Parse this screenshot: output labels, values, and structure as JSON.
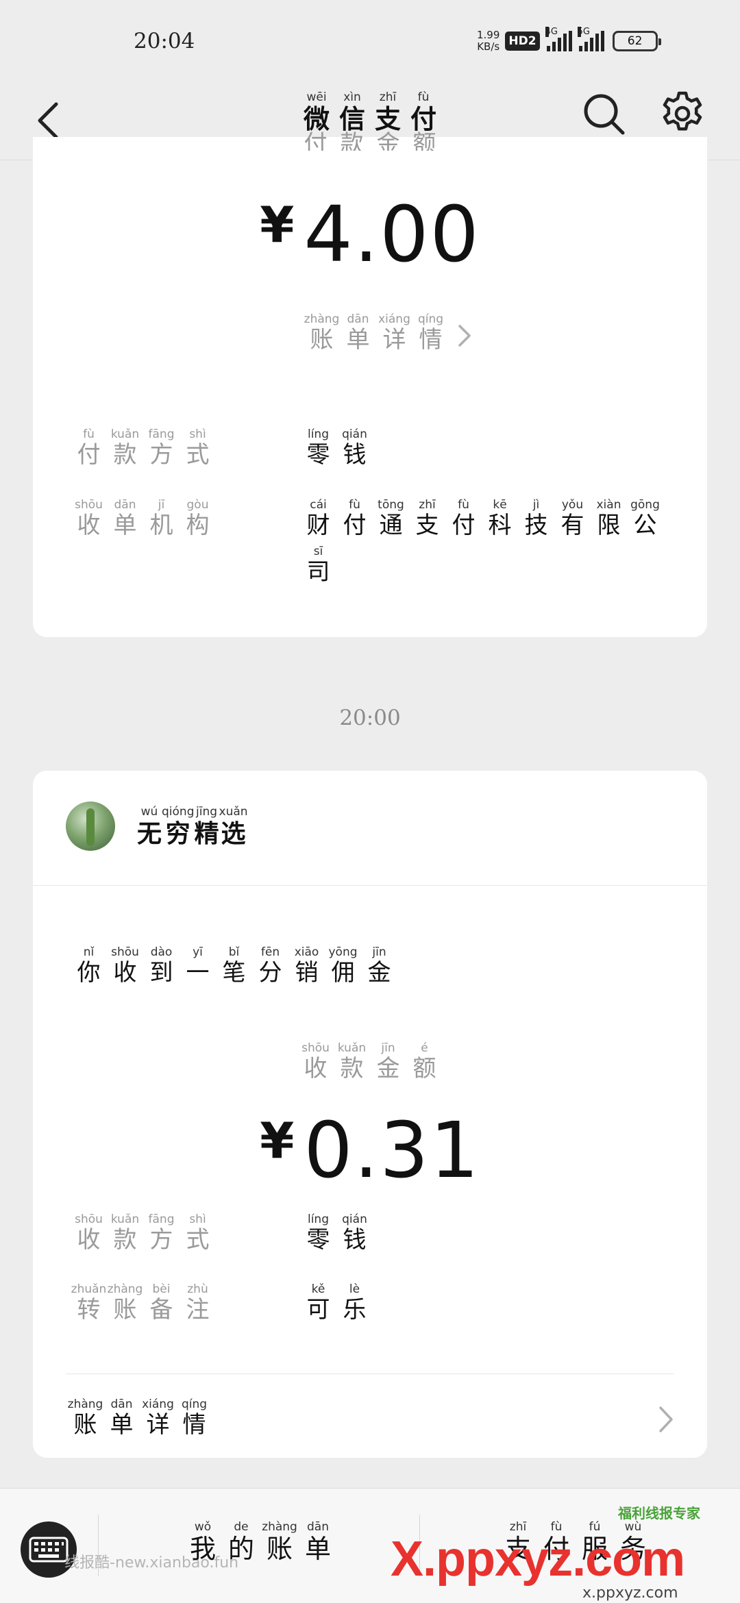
{
  "status_bar": {
    "time": "20:04",
    "net_speed_value": "1.99",
    "net_speed_unit": "KB/s",
    "hd_badge": "HD2",
    "sig1_label": "4G",
    "sig2_label": "5G",
    "battery": "62"
  },
  "nav": {
    "title": [
      {
        "py": "wēi",
        "hz": "微"
      },
      {
        "py": "xìn",
        "hz": "信"
      },
      {
        "py": "zhī",
        "hz": "支"
      },
      {
        "py": "fù",
        "hz": "付"
      }
    ],
    "back_icon": "chevron-left-icon",
    "search_icon": "search-icon",
    "settings_icon": "gear-icon"
  },
  "card1": {
    "partial_label": [
      {
        "py": "",
        "hz": "付"
      },
      {
        "py": "",
        "hz": "款"
      },
      {
        "py": "",
        "hz": "金"
      },
      {
        "py": "",
        "hz": "额"
      }
    ],
    "currency": "¥",
    "amount": "4.00",
    "detail_link": [
      {
        "py": "zhàng",
        "hz": "账"
      },
      {
        "py": "dān",
        "hz": "单"
      },
      {
        "py": "xiáng",
        "hz": "详"
      },
      {
        "py": "qíng",
        "hz": "情"
      }
    ],
    "rows": [
      {
        "label": [
          {
            "py": "fù",
            "hz": "付"
          },
          {
            "py": "kuǎn",
            "hz": "款"
          },
          {
            "py": "fāng",
            "hz": "方"
          },
          {
            "py": "shì",
            "hz": "式"
          }
        ],
        "value": [
          {
            "py": "líng",
            "hz": "零"
          },
          {
            "py": "qián",
            "hz": "钱"
          }
        ]
      },
      {
        "label": [
          {
            "py": "shōu",
            "hz": "收"
          },
          {
            "py": "dān",
            "hz": "单"
          },
          {
            "py": "jī",
            "hz": "机"
          },
          {
            "py": "gòu",
            "hz": "构"
          }
        ],
        "value": [
          {
            "py": "cái",
            "hz": "财"
          },
          {
            "py": "fù",
            "hz": "付"
          },
          {
            "py": "tōng",
            "hz": "通"
          },
          {
            "py": "zhī",
            "hz": "支"
          },
          {
            "py": "fù",
            "hz": "付"
          },
          {
            "py": "kē",
            "hz": "科"
          },
          {
            "py": "jì",
            "hz": "技"
          },
          {
            "py": "yǒu",
            "hz": "有"
          },
          {
            "py": "xiàn",
            "hz": "限"
          },
          {
            "py": "gōng",
            "hz": "公"
          }
        ],
        "value_line2": [
          {
            "py": "sī",
            "hz": "司"
          }
        ]
      }
    ]
  },
  "time_separator": "20:00",
  "card2": {
    "merchant": [
      {
        "py": "wú",
        "hz": "无"
      },
      {
        "py": "qióng",
        "hz": "穷"
      },
      {
        "py": "jīng",
        "hz": "精"
      },
      {
        "py": "xuǎn",
        "hz": "选"
      }
    ],
    "message": [
      {
        "py": "nǐ",
        "hz": "你"
      },
      {
        "py": "shōu",
        "hz": "收"
      },
      {
        "py": "dào",
        "hz": "到"
      },
      {
        "py": "yī",
        "hz": "一"
      },
      {
        "py": "bǐ",
        "hz": "笔"
      },
      {
        "py": "fēn",
        "hz": "分"
      },
      {
        "py": "xiāo",
        "hz": "销"
      },
      {
        "py": "yōng",
        "hz": "佣"
      },
      {
        "py": "jīn",
        "hz": "金"
      }
    ],
    "amount_label": [
      {
        "py": "shōu",
        "hz": "收"
      },
      {
        "py": "kuǎn",
        "hz": "款"
      },
      {
        "py": "jīn",
        "hz": "金"
      },
      {
        "py": "é",
        "hz": "额"
      }
    ],
    "currency": "¥",
    "amount": "0.31",
    "rows": [
      {
        "label": [
          {
            "py": "shōu",
            "hz": "收"
          },
          {
            "py": "kuǎn",
            "hz": "款"
          },
          {
            "py": "fāng",
            "hz": "方"
          },
          {
            "py": "shì",
            "hz": "式"
          }
        ],
        "value": [
          {
            "py": "líng",
            "hz": "零"
          },
          {
            "py": "qián",
            "hz": "钱"
          }
        ]
      },
      {
        "label": [
          {
            "py": "zhuǎn",
            "hz": "转"
          },
          {
            "py": "zhàng",
            "hz": "账"
          },
          {
            "py": "bèi",
            "hz": "备"
          },
          {
            "py": "zhù",
            "hz": "注"
          }
        ],
        "value": [
          {
            "py": "kě",
            "hz": "可"
          },
          {
            "py": "lè",
            "hz": "乐"
          }
        ]
      }
    ],
    "detail_link": [
      {
        "py": "zhàng",
        "hz": "账"
      },
      {
        "py": "dān",
        "hz": "单"
      },
      {
        "py": "xiáng",
        "hz": "详"
      },
      {
        "py": "qíng",
        "hz": "情"
      }
    ]
  },
  "bottom_bar": {
    "keyboard_icon": "keyboard-icon",
    "my_bill": [
      {
        "py": "wǒ",
        "hz": "我"
      },
      {
        "py": "de",
        "hz": "的"
      },
      {
        "py": "zhàng",
        "hz": "账"
      },
      {
        "py": "dān",
        "hz": "单"
      }
    ],
    "pay_service": [
      {
        "py": "zhī",
        "hz": "支"
      },
      {
        "py": "fù",
        "hz": "付"
      },
      {
        "py": "fú",
        "hz": "服"
      },
      {
        "py": "wù",
        "hz": "务"
      }
    ],
    "watermark_left": "线报酷-new.xianbao.fun",
    "watermark_logo": "X.ppxyz.com",
    "watermark_sub": "x.ppxyz.com",
    "watermark_badge": "福利线报专家"
  }
}
